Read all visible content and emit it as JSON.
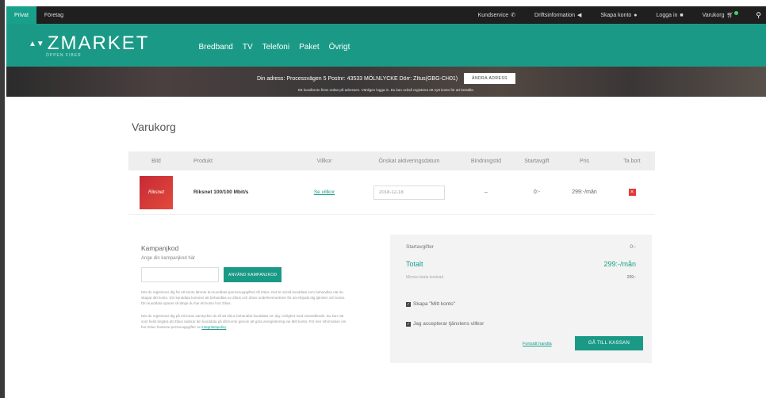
{
  "topbar": {
    "tabs": [
      {
        "label": "Privat",
        "active": true
      },
      {
        "label": "Företag",
        "active": false
      }
    ],
    "links": {
      "customer_service": "Kundservice",
      "operating_info": "Driftsinformation",
      "create_account": "Skapa konto",
      "login": "Logga in",
      "cart": "Varukorg"
    },
    "icons": [
      "phone-icon",
      "megaphone-icon",
      "user-icon",
      "lock-icon",
      "cart-icon",
      "search-icon"
    ]
  },
  "header": {
    "logo": {
      "mark": "▲▼",
      "name": "ZMARKET",
      "tagline": "ÖPPEN FIBER"
    },
    "nav": [
      "Bredband",
      "TV",
      "Telefoni",
      "Paket",
      "Övrigt"
    ]
  },
  "banner": {
    "address_text": "Din adress: Processvägen 5  Postnr: 43533 MÖLNLYCKE  Dörr: ZItus(GBG-CH01)",
    "change_button": "ÄNDRA ADRESS",
    "note": "Ett kundkonto finns redan på adressen. Vänligen logga in. Du kan också registrera ett nytt konto för att beställa."
  },
  "page": {
    "title": "Varukorg"
  },
  "cart": {
    "headers": [
      "Bild",
      "Produkt",
      "Villkor",
      "Önskat aktiveringsdatum",
      "Bindningstid",
      "Startavgift",
      "Pris",
      "Ta bort"
    ],
    "items": [
      {
        "image_label": "Riksnet",
        "product": "Riksnet 100/100 Mbit/s",
        "terms": "Se villkor",
        "activation_date": "2018-12-18",
        "binding": "–",
        "start_fee": "0:-",
        "price": "299:-/mån",
        "remove": "×"
      }
    ]
  },
  "campaign": {
    "title": "Kampanjkod",
    "subtitle": "Ange din kampanjkod här",
    "button": "ANVÄND KAMPANJKOD",
    "text1": "När du registrerar dig för ett konto lämnar du kunddata (personuppgifter) till Zitius. Det är också kunddata som behandlas när du skapar ditt konto. Din kunddata kommer att behandlas av Zitius och Zitius underleverantörer för att erbjuda dig tjänster och konto. Din kunddata sparas så länge du har ett konto hos Zitius.",
    "text2": "När du registrerar dig på ett konto samtycker du till att Zitius behandlar kunddata om dig i enlighet med ovanstående. Du kan när som helst begära att Zitius raderar din kunddata på ditt konto genom att göra avregistrering via Mitt konto. För mer information om hur Zitius hanterar personuppgifter se",
    "policy_link": "integritetspolicy"
  },
  "summary": {
    "start_fees_label": "Startavgifter",
    "start_fees_value": "0:-",
    "total_label": "Totalt",
    "total_value": "299:-/mån",
    "min_cost_label": "Minsta totala kostnad",
    "min_cost_value": "299:-",
    "create_account_check": "Skapa \"Mitt konto\"",
    "accept_terms_check": "Jag accepterar tjänstens villkor",
    "continue_link": "Fortsätt handla",
    "checkout_button": "GÅ TILL KASSAN"
  },
  "colors": {
    "brand": "#1a9a86",
    "remove": "#e23b3b",
    "topbar": "#1f1f1f"
  }
}
